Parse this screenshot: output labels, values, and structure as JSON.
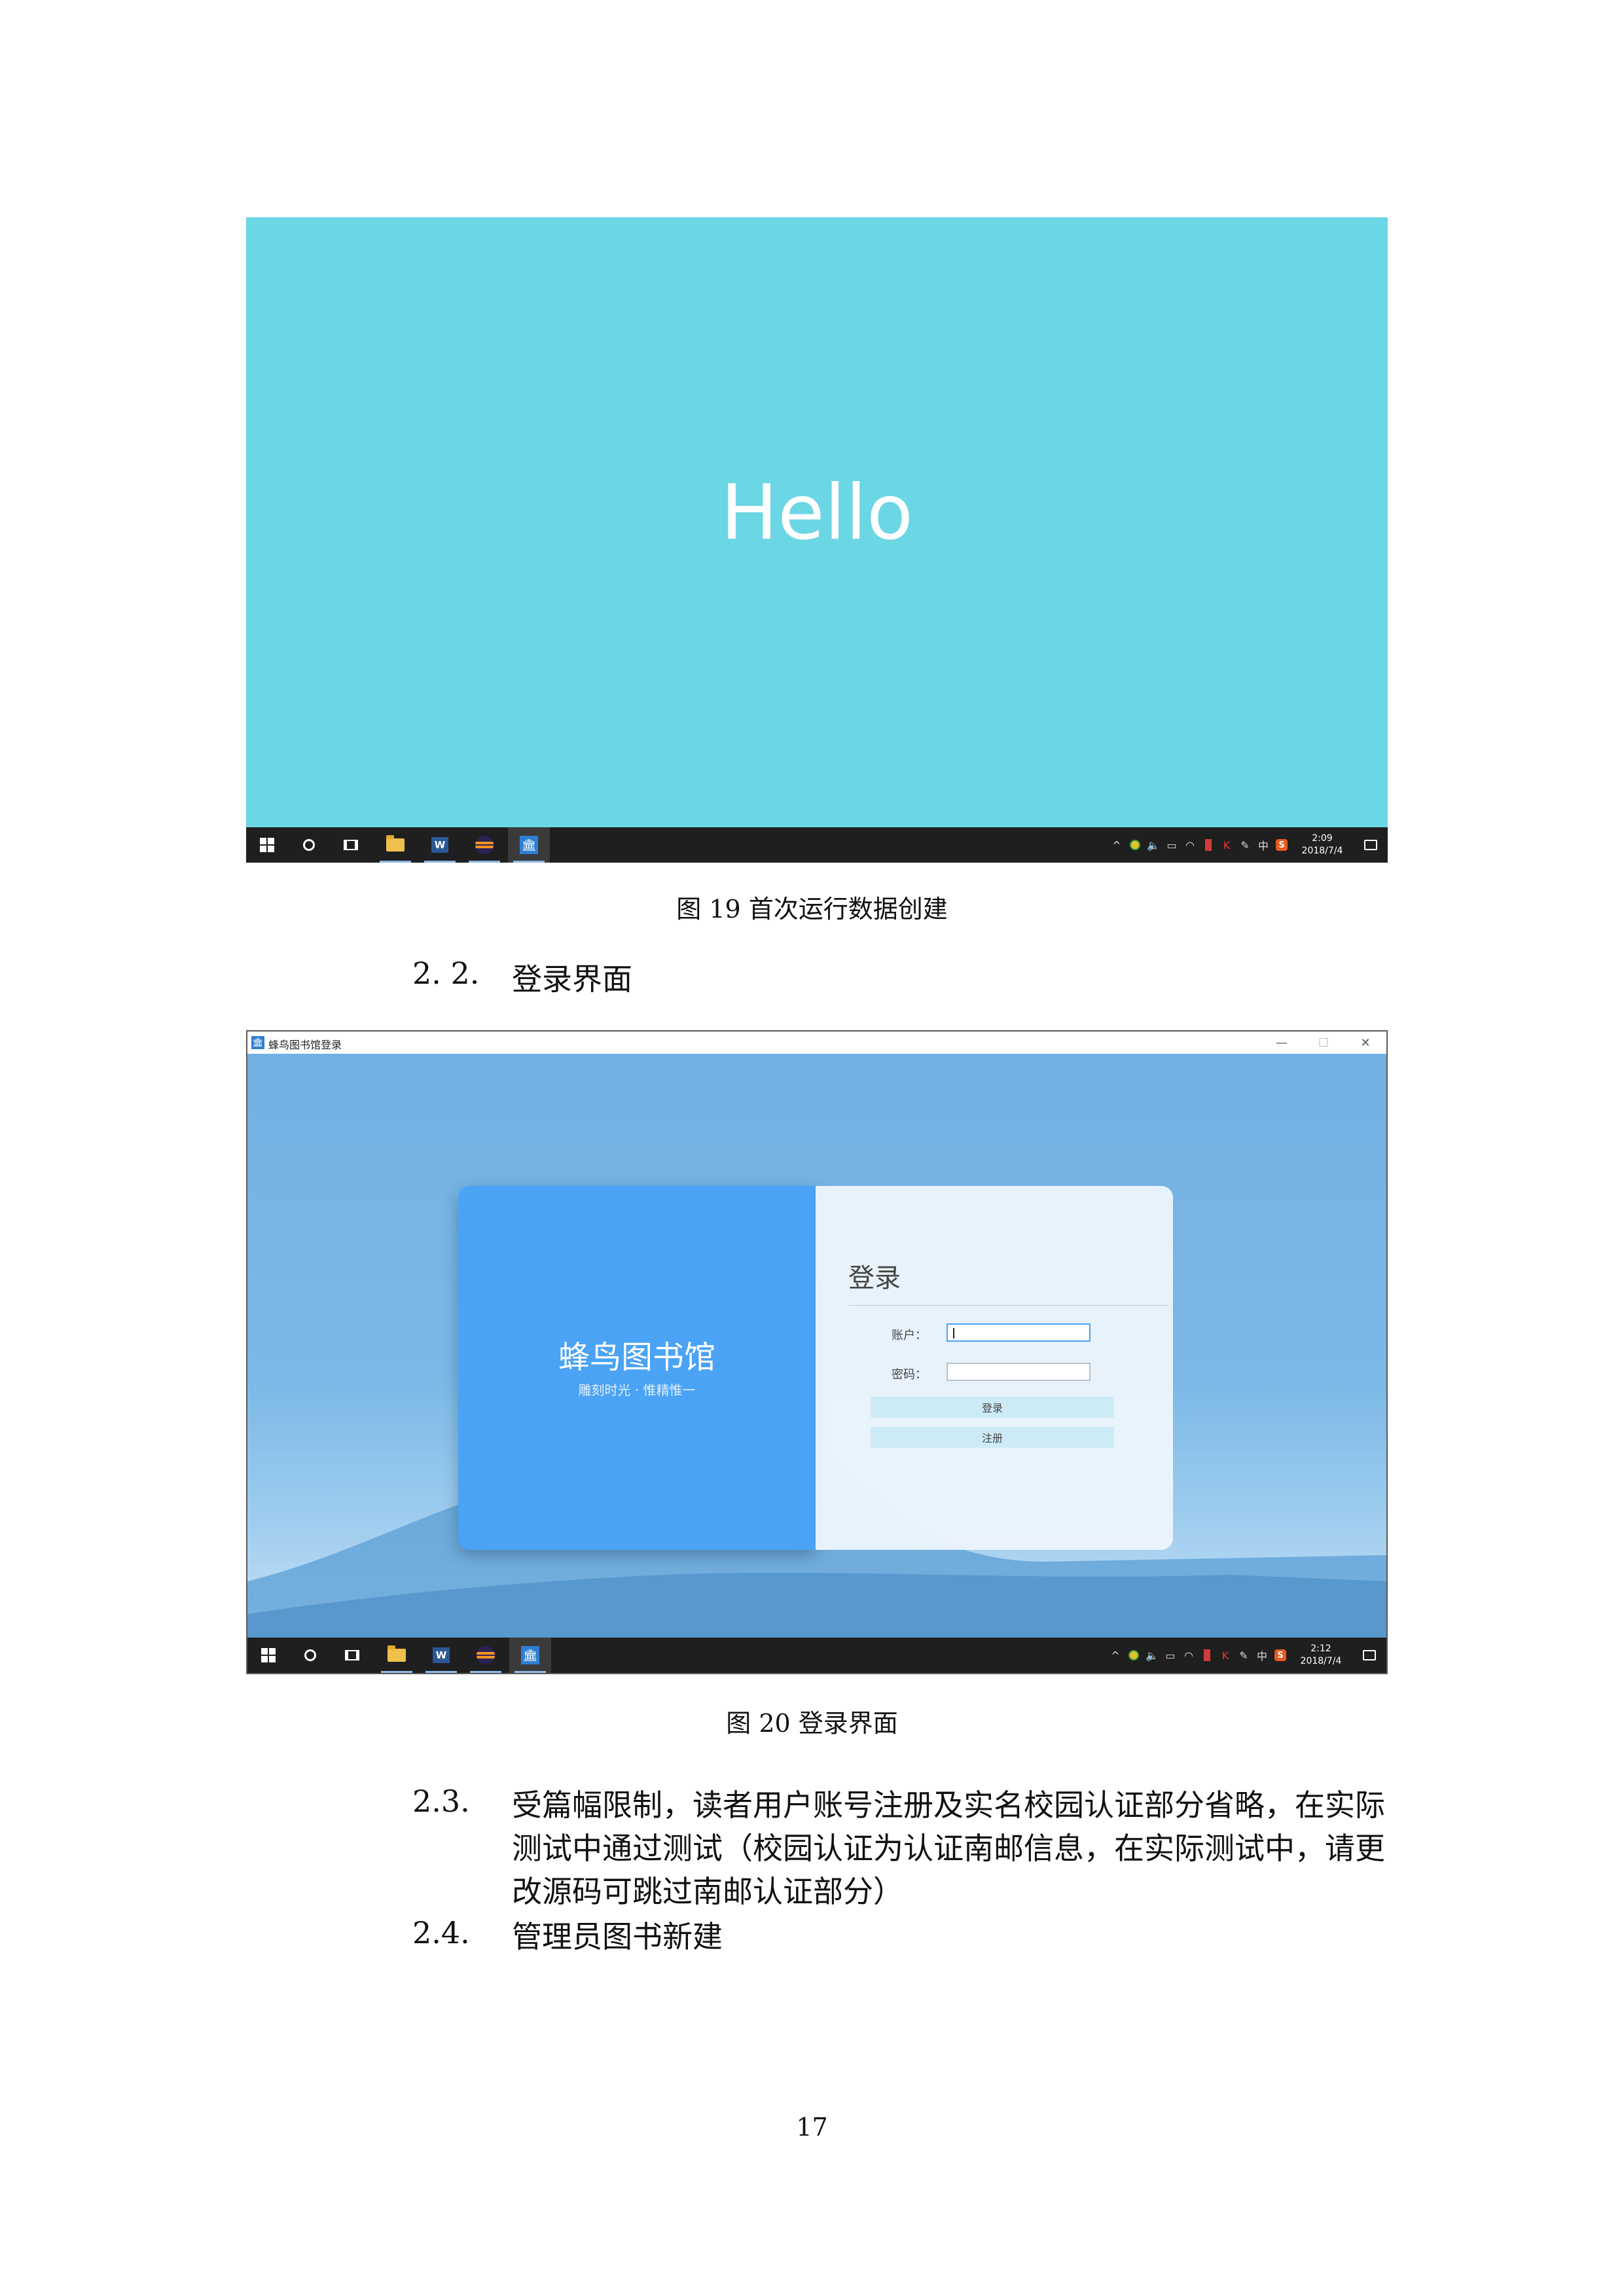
{
  "figure19": {
    "hello_text": "Hello",
    "caption": "图 19 首次运行数据创建",
    "taskbar": {
      "time": "2:09",
      "date": "2018/7/4"
    }
  },
  "section_2_2": {
    "number": "2. 2.",
    "title": "登录界面"
  },
  "figure20": {
    "window_title": "蜂鸟图书馆登录",
    "window_controls": {
      "minimize": "—",
      "maximize": "☐",
      "close": "✕"
    },
    "brand_title": "蜂鸟图书馆",
    "brand_slogan": "雕刻时光 · 惟精惟一",
    "login_heading": "登录",
    "account_label": "账户：",
    "password_label": "密码：",
    "login_button": "登录",
    "register_button": "注册",
    "caption": "图 20 登录界面",
    "taskbar": {
      "time": "2:12",
      "date": "2018/7/4"
    }
  },
  "taskbar_common": {
    "word_label": "W",
    "tray_chevron": "^",
    "tray_volume": "🔈",
    "tray_battery": "▭",
    "tray_wifi": "◠",
    "tray_k": "K",
    "tray_pen": "✎",
    "tray_ime": "中",
    "tray_sougou": "S",
    "lib_icon": "🏛"
  },
  "list": [
    {
      "number": "2.3.",
      "text": "受篇幅限制，读者用户账号注册及实名校园认证部分省略，在实际测试中通过测试（校园认证为认证南邮信息，在实际测试中，请更改源码可跳过南邮认证部分）"
    },
    {
      "number": "2.4.",
      "text": "管理员图书新建"
    }
  ],
  "page_number": "17"
}
